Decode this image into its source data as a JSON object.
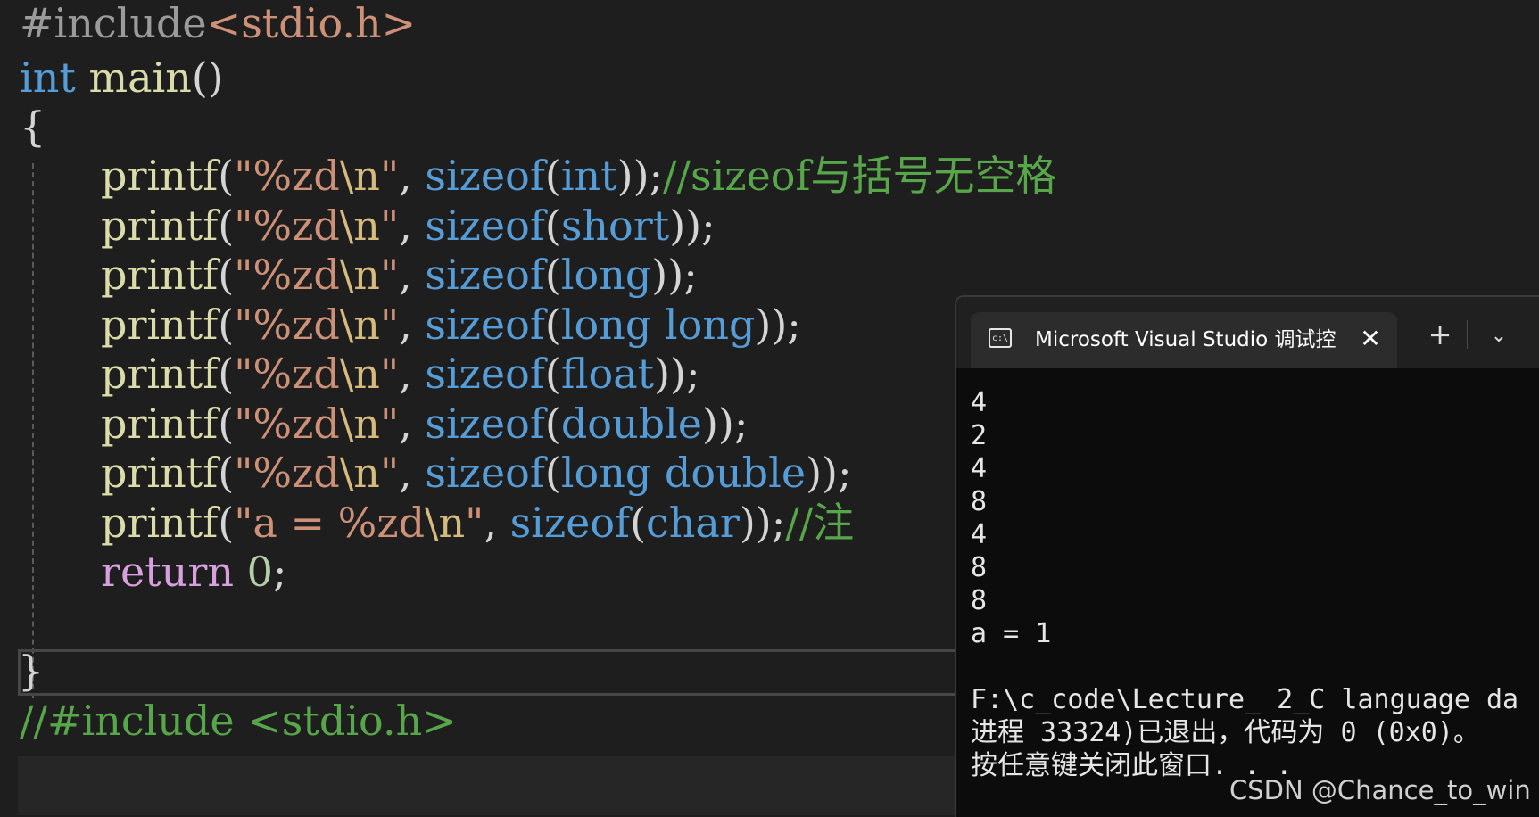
{
  "editor": {
    "line1": {
      "directive": "#include",
      "header": "<stdio.h>"
    },
    "line2": {
      "type": "int",
      "name": "main",
      "parens": "()"
    },
    "open_brace": "{",
    "printf_lines": [
      {
        "fn": "printf",
        "open": "(",
        "str_open": "\"%zd",
        "esc": "\\n",
        "str_close": "\"",
        "comma": ", ",
        "sizeof": "sizeof",
        "arg": "int",
        "close": "));",
        "comment": "//sizeof与括号无空格"
      },
      {
        "fn": "printf",
        "open": "(",
        "str_open": "\"%zd",
        "esc": "\\n",
        "str_close": "\"",
        "comma": ", ",
        "sizeof": "sizeof",
        "arg": "short",
        "close": "));",
        "comment": ""
      },
      {
        "fn": "printf",
        "open": "(",
        "str_open": "\"%zd",
        "esc": "\\n",
        "str_close": "\"",
        "comma": ", ",
        "sizeof": "sizeof",
        "arg": "long",
        "close": "));",
        "comment": ""
      },
      {
        "fn": "printf",
        "open": "(",
        "str_open": "\"%zd",
        "esc": "\\n",
        "str_close": "\"",
        "comma": ", ",
        "sizeof": "sizeof",
        "arg": "long long",
        "close": "));",
        "comment": ""
      },
      {
        "fn": "printf",
        "open": "(",
        "str_open": "\"%zd",
        "esc": "\\n",
        "str_close": "\"",
        "comma": ", ",
        "sizeof": "sizeof",
        "arg": "float",
        "close": "));",
        "comment": ""
      },
      {
        "fn": "printf",
        "open": "(",
        "str_open": "\"%zd",
        "esc": "\\n",
        "str_close": "\"",
        "comma": ", ",
        "sizeof": "sizeof",
        "arg": "double",
        "close": "));",
        "comment": ""
      },
      {
        "fn": "printf",
        "open": "(",
        "str_open": "\"%zd",
        "esc": "\\n",
        "str_close": "\"",
        "comma": ", ",
        "sizeof": "sizeof",
        "arg": "long double",
        "close": "));",
        "comment": ""
      },
      {
        "fn": "printf",
        "open": "(",
        "str_open": "\"a = %zd",
        "esc": "\\n",
        "str_close": "\"",
        "comma": ", ",
        "sizeof": "sizeof",
        "arg": "char",
        "close": "));",
        "comment": "//注"
      }
    ],
    "return_line": {
      "kw": "return",
      "value": "0",
      "semi": ";"
    },
    "close_brace": "}",
    "last_comment": "//#include <stdio.h>"
  },
  "terminal": {
    "tab_title": "Microsoft Visual Studio 调试控",
    "tab_icon_text": "c:\\",
    "close_glyph": "✕",
    "plus_glyph": "+",
    "chevron_glyph": "⌄",
    "output_lines": [
      "4",
      "2",
      "4",
      "8",
      "4",
      "8",
      "8",
      "a = 1",
      "",
      "F:\\c_code\\Lecture_ 2_C language da",
      "进程 33324)已退出，代码为 0 (0x0)。",
      "按任意键关闭此窗口. . ."
    ]
  },
  "watermark": "CSDN @Chance_to_win"
}
